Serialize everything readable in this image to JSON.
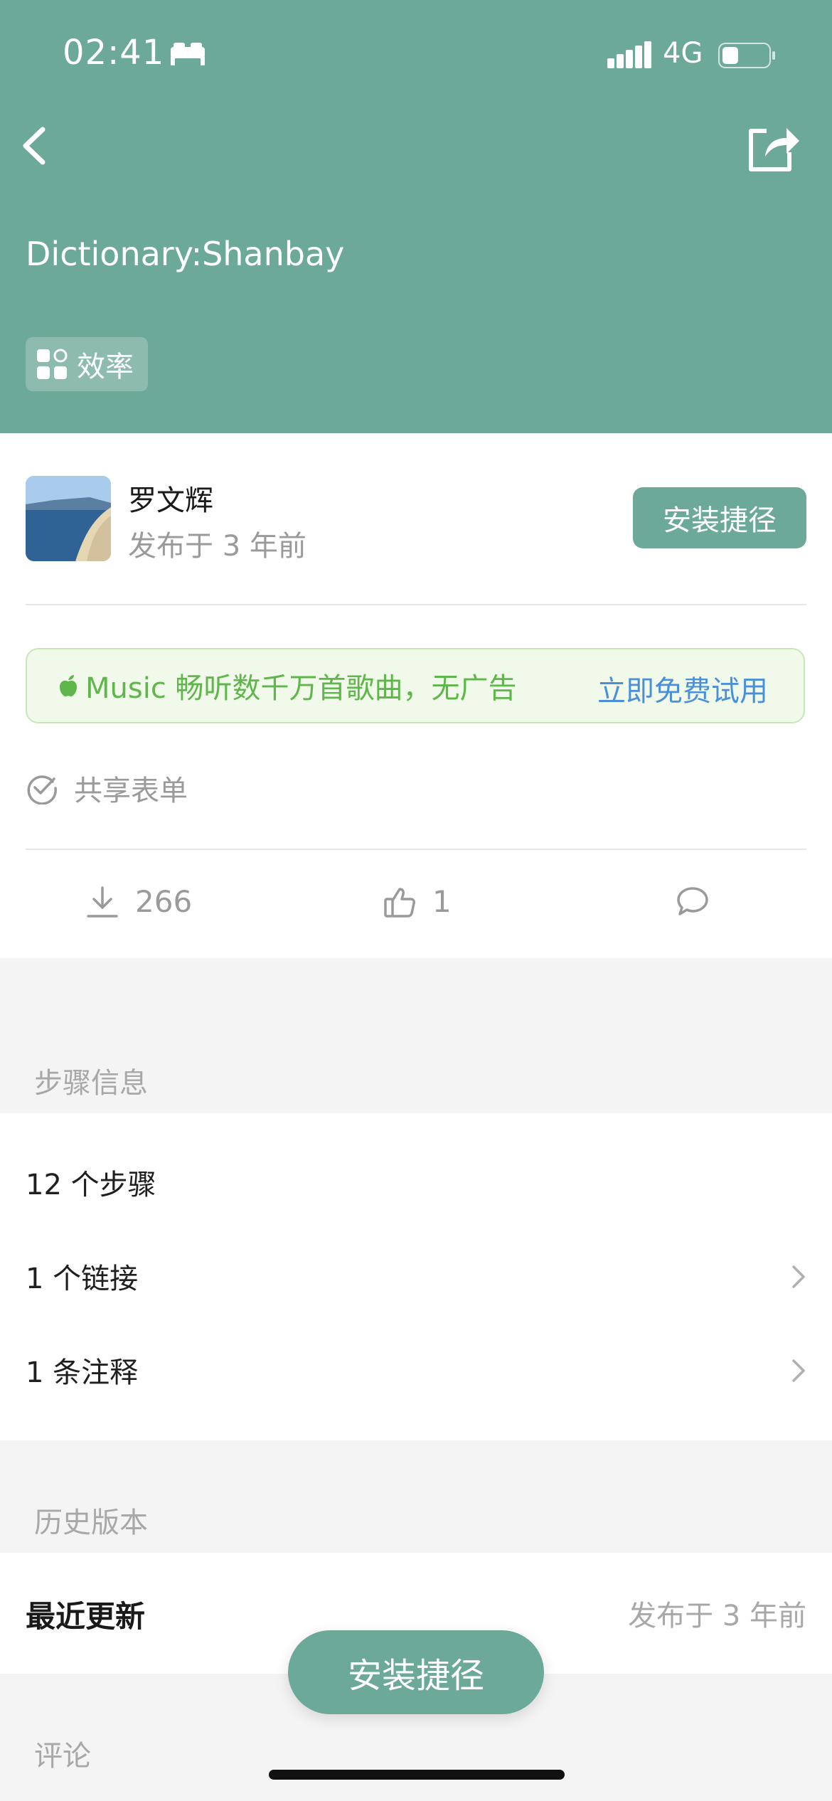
{
  "status_bar": {
    "time": "02:41",
    "network": "4G"
  },
  "header": {
    "title": "Dictionary:Shanbay",
    "category": "效率",
    "background_color": "#6da999"
  },
  "author": {
    "name": "罗文辉",
    "published": "发布于 3 年前",
    "install_label": "安装捷径"
  },
  "promo": {
    "text": "Music 畅听数千万首歌曲，无广告",
    "link": "立即免费试用"
  },
  "shared_form": {
    "label": "共享表单"
  },
  "stats": {
    "downloads": "266",
    "likes": "1"
  },
  "steps_section": {
    "title": "步骤信息",
    "rows": [
      {
        "label": "12 个步骤"
      },
      {
        "label": "1 个链接"
      },
      {
        "label": "1 条注释"
      }
    ]
  },
  "history_section": {
    "title": "历史版本",
    "recent_label": "最近更新",
    "recent_value": "发布于 3 年前"
  },
  "comments_section": {
    "title": "评论"
  },
  "floating_button": {
    "label": "安装捷径"
  },
  "icons": [
    "bed-icon",
    "signal-icon",
    "battery-icon",
    "back-arrow-icon",
    "share-icon",
    "category-grid-icon",
    "apple-icon",
    "check-circle-icon",
    "download-icon",
    "thumbs-up-icon",
    "comment-icon",
    "chevron-right-icon"
  ]
}
